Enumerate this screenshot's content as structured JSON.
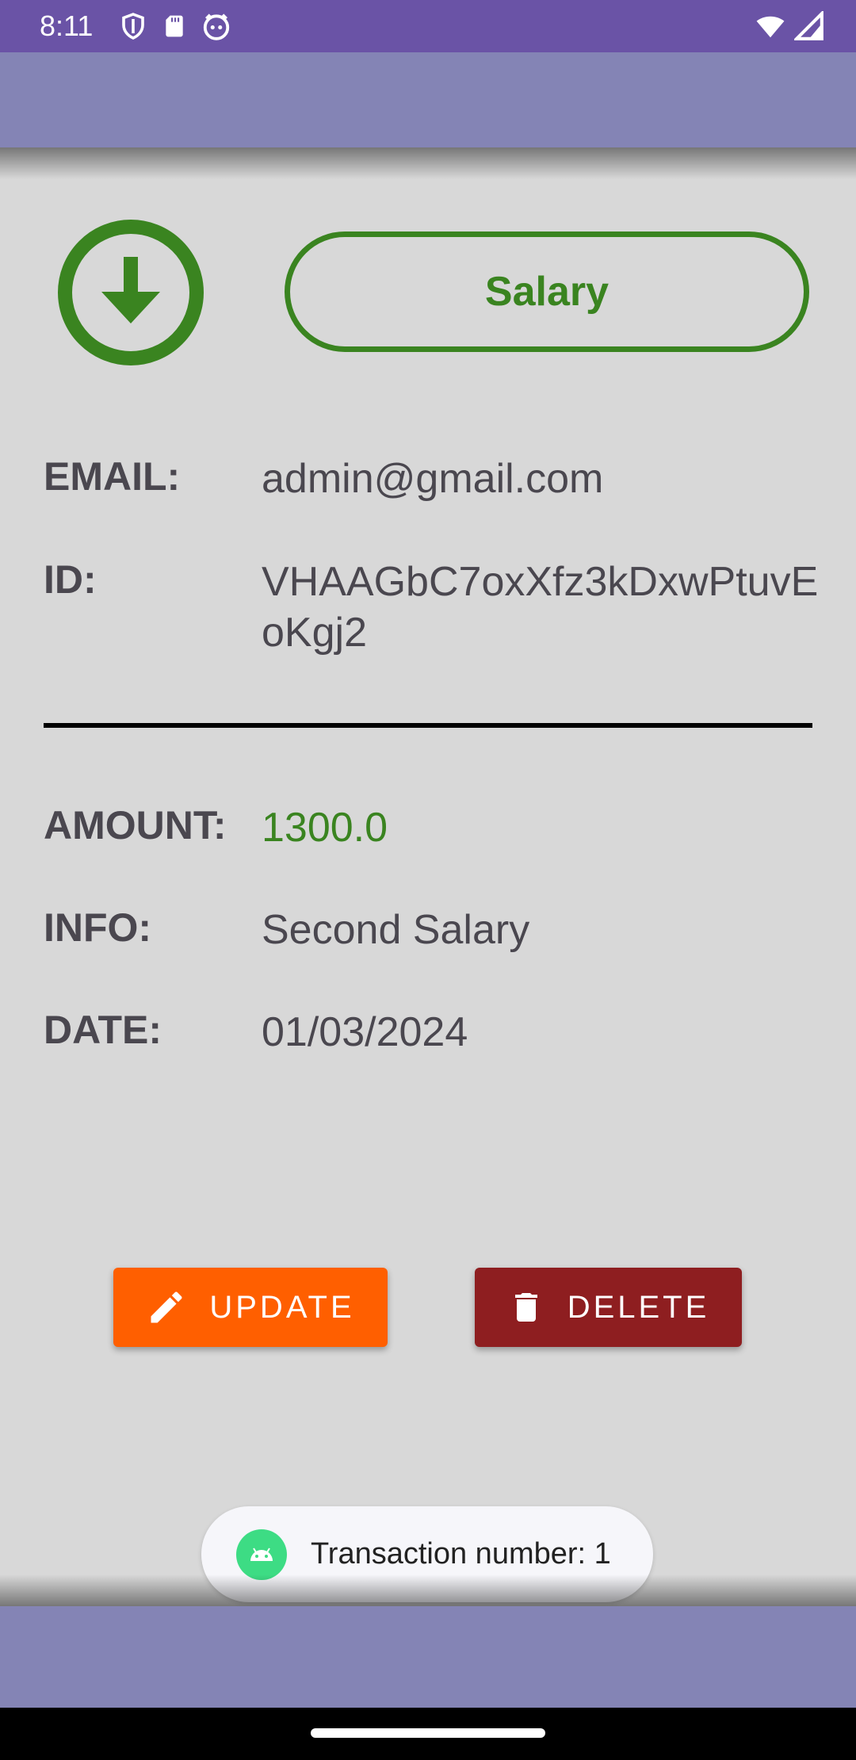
{
  "status_bar": {
    "time": "8:11",
    "icons_left": [
      "shield-icon",
      "sd-card-icon",
      "cat-face-icon"
    ],
    "icons_right": [
      "wifi-icon",
      "signal-icon"
    ]
  },
  "header": {
    "category": "Salary",
    "type_icon": "download-arrow-icon",
    "accent_color": "#3a8420"
  },
  "details": {
    "email_label": "EMAIL:",
    "email_value": "admin@gmail.com",
    "id_label": "ID:",
    "id_value": "VHAAGbC7oxXfz3kDxwPtuvEoKgj2",
    "amount_label": "AMOUNT:",
    "amount_value": "1300.0",
    "info_label": "INFO:",
    "info_value": "Second Salary",
    "date_label": "DATE:",
    "date_value": "01/03/2024"
  },
  "actions": {
    "update_label": "UPDATE",
    "update_color": "#ff5f00",
    "delete_label": "DELETE",
    "delete_color": "#8e1e20"
  },
  "toast": {
    "text": "Transaction number: 1",
    "icon": "android-icon"
  }
}
